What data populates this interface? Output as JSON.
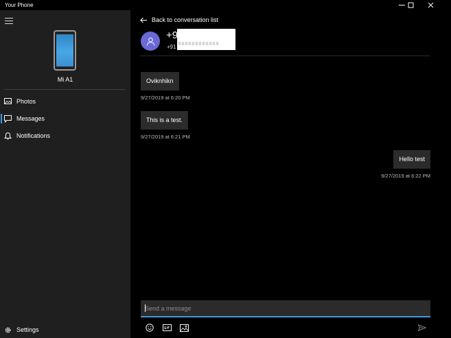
{
  "window": {
    "title": "Your Phone",
    "controls": [
      "minimize-icon",
      "maximize-icon",
      "close-icon"
    ]
  },
  "sidebar": {
    "menu_icon": "hamburger-icon",
    "device_name": "Mi A1",
    "items": [
      {
        "label": "Photos",
        "icon": "photos-icon",
        "active": false
      },
      {
        "label": "Messages",
        "icon": "messages-icon",
        "active": true
      },
      {
        "label": "Notifications",
        "icon": "bell-icon",
        "active": false
      }
    ],
    "settings": {
      "label": "Settings",
      "icon": "gear-icon"
    }
  },
  "conversation": {
    "back_label": "Back to conversation list",
    "contact_primary": "+91",
    "contact_secondary": "+91",
    "avatar_icon": "person-icon",
    "messages": [
      {
        "text": "Oviknhikn",
        "timestamp": "9/27/2019 at 6:20 PM",
        "direction": "incoming"
      },
      {
        "text": "This is a test.",
        "timestamp": "9/27/2019 at 6:21 PM",
        "direction": "incoming"
      },
      {
        "text": "Hello test",
        "timestamp": "9/27/2019 at 6:22 PM",
        "direction": "outgoing"
      }
    ],
    "compose": {
      "placeholder": "Send a message",
      "value": ""
    },
    "toolbar": [
      "emoji-icon",
      "gif-icon",
      "image-icon",
      "send-icon"
    ],
    "accent": "#3d9ae0",
    "avatar_color": "#6b69d6"
  }
}
